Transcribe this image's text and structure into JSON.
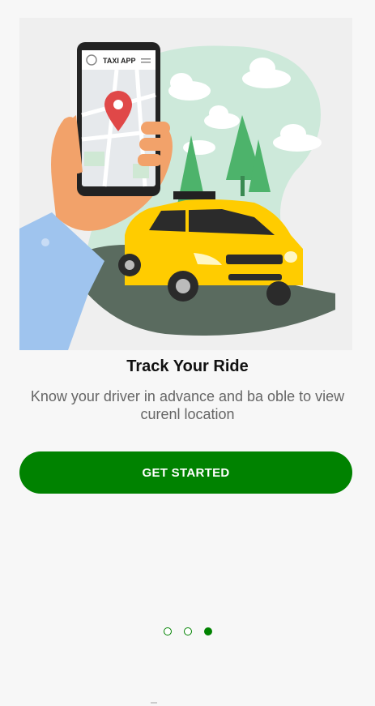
{
  "illustration": {
    "phone_header": "TAXI APP",
    "colors": {
      "taxi": "#ffcc00",
      "button": "#008200",
      "map_pin": "#e04848",
      "trees": "#4db36b",
      "sleeve": "#9fc4ee"
    }
  },
  "onboarding": {
    "title": "Track Your Ride",
    "subtitle": "Know your driver in advance and ba oble to view curenl location"
  },
  "cta": {
    "label": "GET STARTED"
  },
  "pager": {
    "total": 3,
    "active_index": 3
  }
}
